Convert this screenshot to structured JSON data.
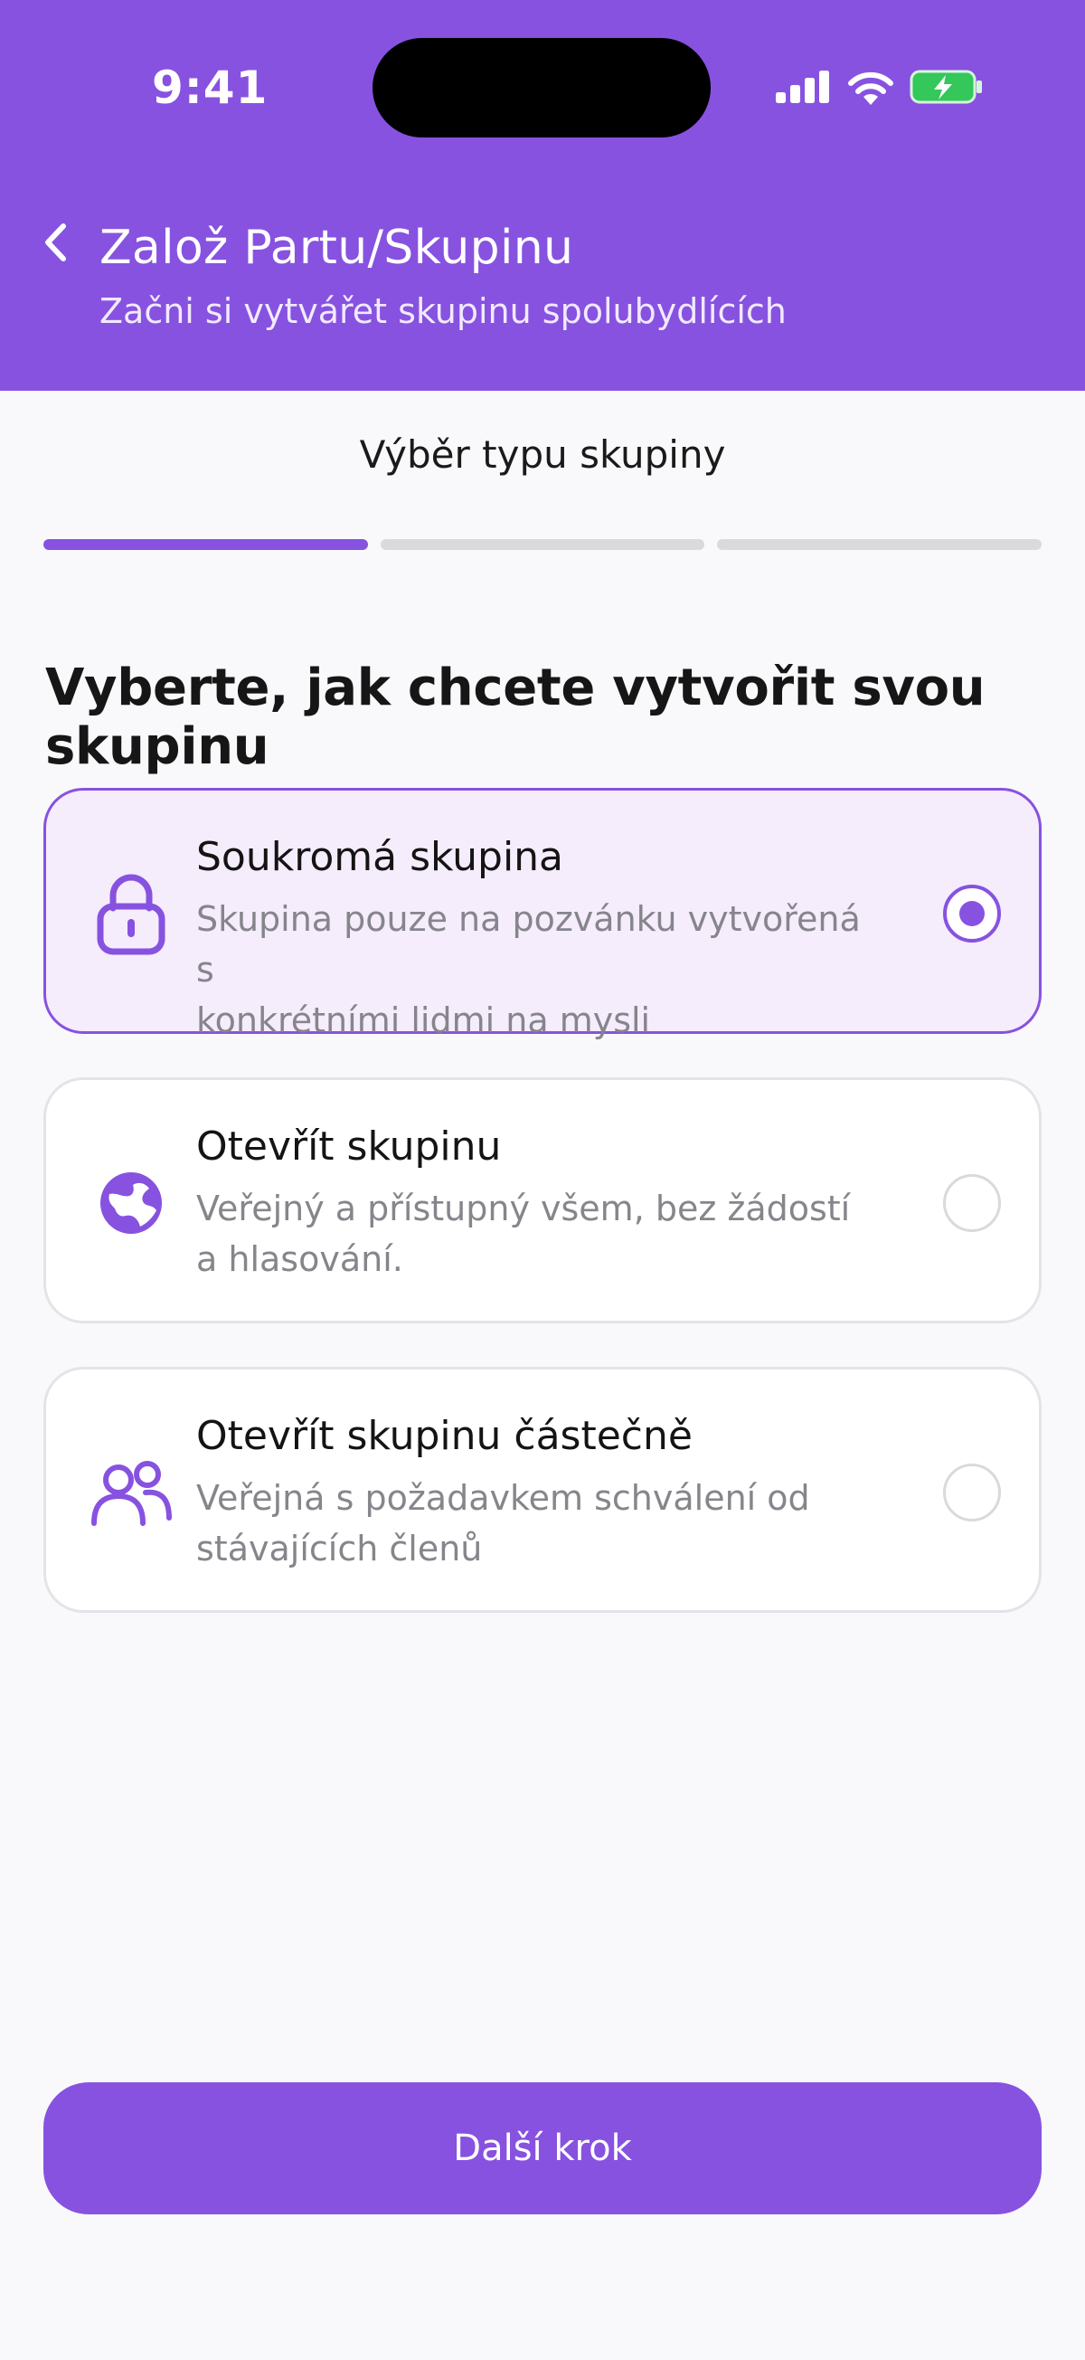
{
  "status_bar": {
    "time": "9:41"
  },
  "header": {
    "title": "Založ Partu/Skupinu",
    "subtitle": "Začni si vytvářet skupinu spolubydlících",
    "background": "#8752e0"
  },
  "step": {
    "title": "Výběr typu skupiny",
    "current": 1,
    "total": 3
  },
  "question": "Vyberte, jak chcete vytvořit svou skupinu",
  "options": [
    {
      "icon": "lock-icon",
      "title": "Soukromá skupina",
      "desc_line1": "Skupina pouze na pozvánku vytvořená s",
      "desc_line2": "konkrétními lidmi na mysli",
      "selected": true
    },
    {
      "icon": "globe-icon",
      "title": "Otevřít skupinu",
      "desc_line1": "Veřejný a přístupný všem, bez žádostí",
      "desc_line2": "a hlasování.",
      "selected": false
    },
    {
      "icon": "users-icon",
      "title": "Otevřít skupinu částečně",
      "desc_line1": "Veřejná s požadavkem schválení od",
      "desc_line2": "stávajících členů",
      "selected": false
    }
  ],
  "next_button": {
    "label": "Další krok"
  },
  "colors": {
    "accent": "#8752e0",
    "selected_card_bg": "#f5ecfc",
    "battery_green": "#34c759"
  }
}
